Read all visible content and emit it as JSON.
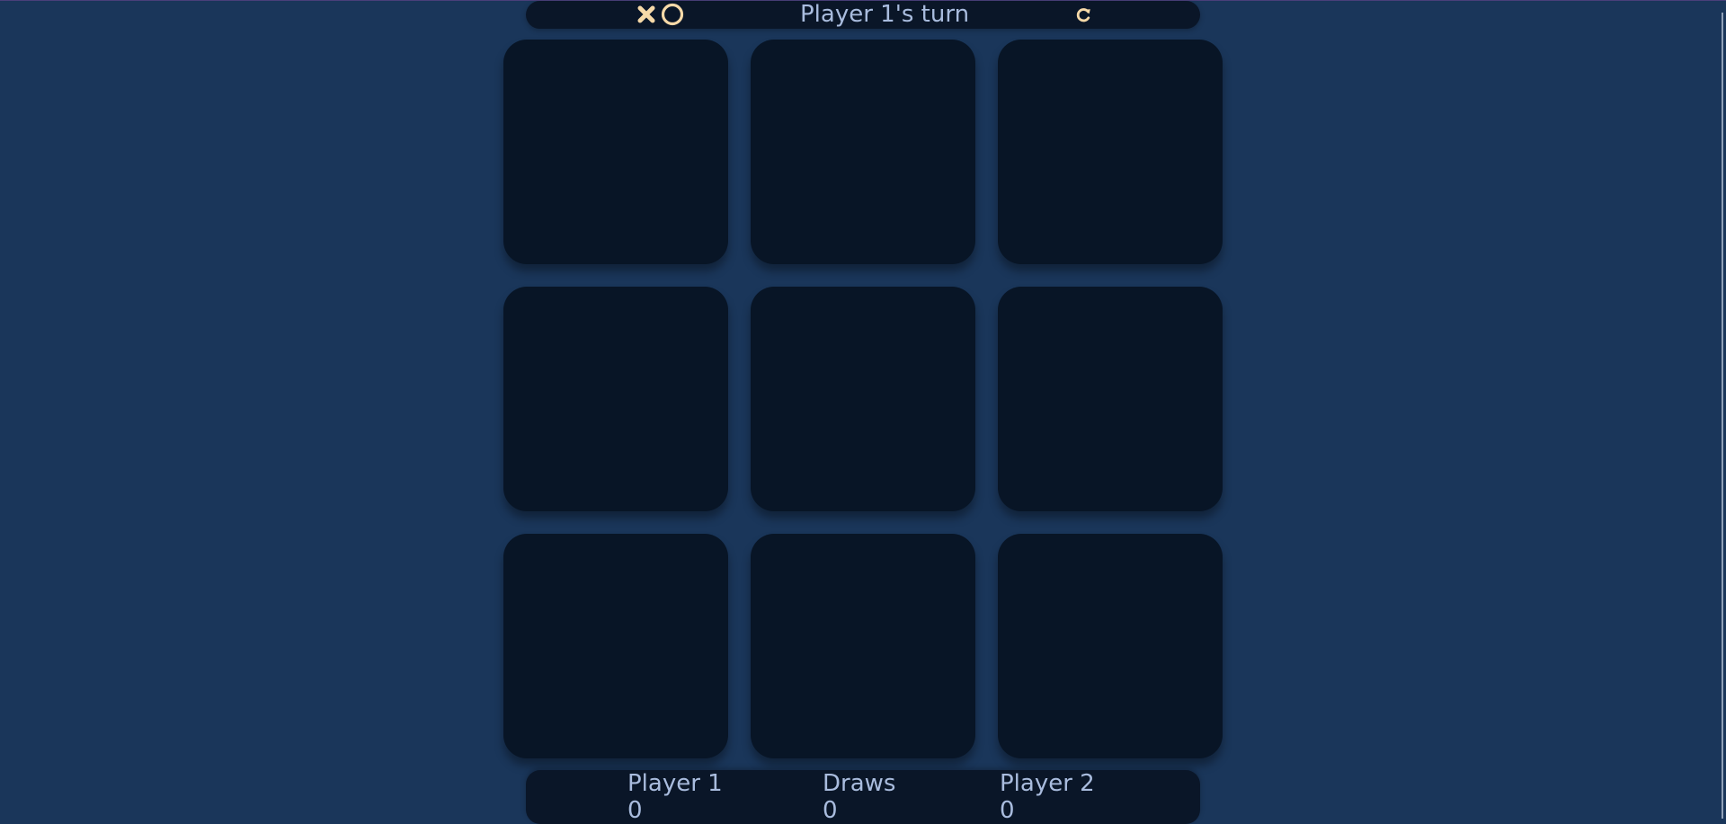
{
  "header": {
    "logo_icons": [
      "x-icon",
      "o-icon"
    ],
    "turn_text": "Player 1's turn",
    "restart_icon": "restart-icon"
  },
  "board": {
    "rows": 3,
    "cols": 3,
    "cells": [
      "",
      "",
      "",
      "",
      "",
      "",
      "",
      "",
      ""
    ]
  },
  "scores": {
    "player1": {
      "label": "Player 1",
      "value": "0"
    },
    "draws": {
      "label": "Draws",
      "value": "0"
    },
    "player2": {
      "label": "Player 2",
      "value": "0"
    }
  },
  "colors": {
    "background": "#1a365a",
    "panel": "#0a1628",
    "cell": "#081526",
    "accent": "#f6d9a8",
    "text": "#a9bcde"
  }
}
